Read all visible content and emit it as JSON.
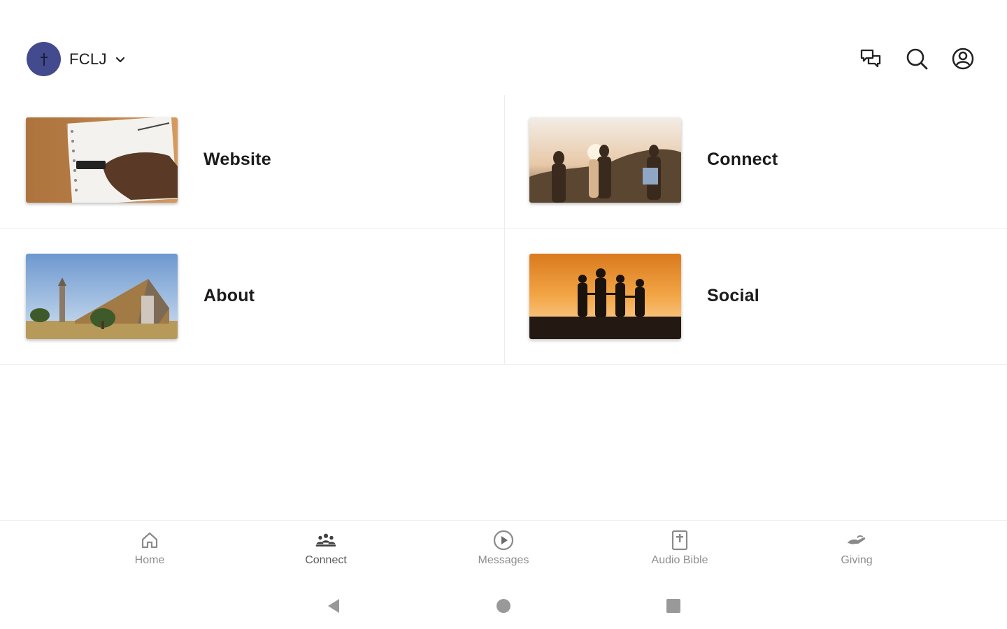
{
  "header": {
    "org_name": "FCLJ",
    "icons": [
      "cross-icon",
      "chevron-down-icon",
      "chat-icon",
      "search-icon",
      "account-icon"
    ]
  },
  "tiles": [
    {
      "label": "Website",
      "image": "notebook-writing-photo"
    },
    {
      "label": "Connect",
      "image": "friends-sunset-photo"
    },
    {
      "label": "About",
      "image": "church-building-photo"
    },
    {
      "label": "Social",
      "image": "family-silhouette-sunset-photo"
    }
  ],
  "bottom_nav": {
    "active": "Connect",
    "items": [
      {
        "label": "Home",
        "icon": "home-icon"
      },
      {
        "label": "Connect",
        "icon": "people-icon"
      },
      {
        "label": "Messages",
        "icon": "play-circle-icon"
      },
      {
        "label": "Audio Bible",
        "icon": "bible-icon"
      },
      {
        "label": "Giving",
        "icon": "giving-hand-icon"
      }
    ]
  },
  "system_nav": [
    "back-icon",
    "home-circle-icon",
    "recents-square-icon"
  ],
  "colors": {
    "brand": "#434a8d",
    "nav_label": "#8e8e8e"
  }
}
